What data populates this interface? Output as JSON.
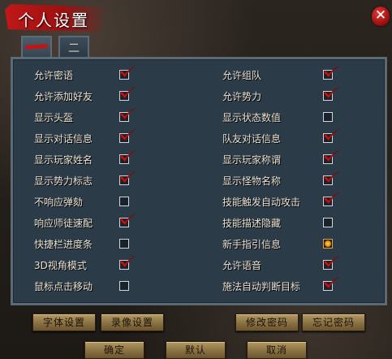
{
  "window": {
    "title": "个人设置",
    "close_glyph": "✕"
  },
  "tabs": [
    {
      "label": "一",
      "active": true
    },
    {
      "label": "二",
      "active": false
    }
  ],
  "options_left": [
    {
      "label": "允许密语",
      "checked": true
    },
    {
      "label": "允许添加好友",
      "checked": true
    },
    {
      "label": "显示头盔",
      "checked": true
    },
    {
      "label": "显示对话信息",
      "checked": true
    },
    {
      "label": "显示玩家姓名",
      "checked": true
    },
    {
      "label": "显示势力标志",
      "checked": true
    },
    {
      "label": "不响应弹劾",
      "checked": false
    },
    {
      "label": "响应师徒速配",
      "checked": true
    },
    {
      "label": "快捷栏进度条",
      "checked": false
    },
    {
      "label": "3D视角模式",
      "checked": true
    },
    {
      "label": "鼠标点击移动",
      "checked": false
    }
  ],
  "options_right": [
    {
      "label": "允许组队",
      "checked": true
    },
    {
      "label": "允许势力",
      "checked": true
    },
    {
      "label": "显示状态数值",
      "checked": false
    },
    {
      "label": "队友对话信息",
      "checked": true
    },
    {
      "label": "显示玩家称谓",
      "checked": true
    },
    {
      "label": "显示怪物名称",
      "checked": true
    },
    {
      "label": "技能触发自动攻击",
      "checked": true
    },
    {
      "label": "技能描述隐藏",
      "checked": false
    },
    {
      "label": "新手指引信息",
      "checked": "special"
    },
    {
      "label": "允许语音",
      "checked": true
    },
    {
      "label": "施法自动判断目标",
      "checked": true
    }
  ],
  "buttons": {
    "font_settings": "字体设置",
    "video_settings": "录像设置",
    "change_password": "修改密码",
    "forgot_password": "忘记密码",
    "confirm": "确定",
    "default": "默认",
    "cancel": "取消"
  },
  "colors": {
    "accent_red": "#c31414",
    "panel_bg": "#2c3b48",
    "button_gold": "#a68b58"
  }
}
